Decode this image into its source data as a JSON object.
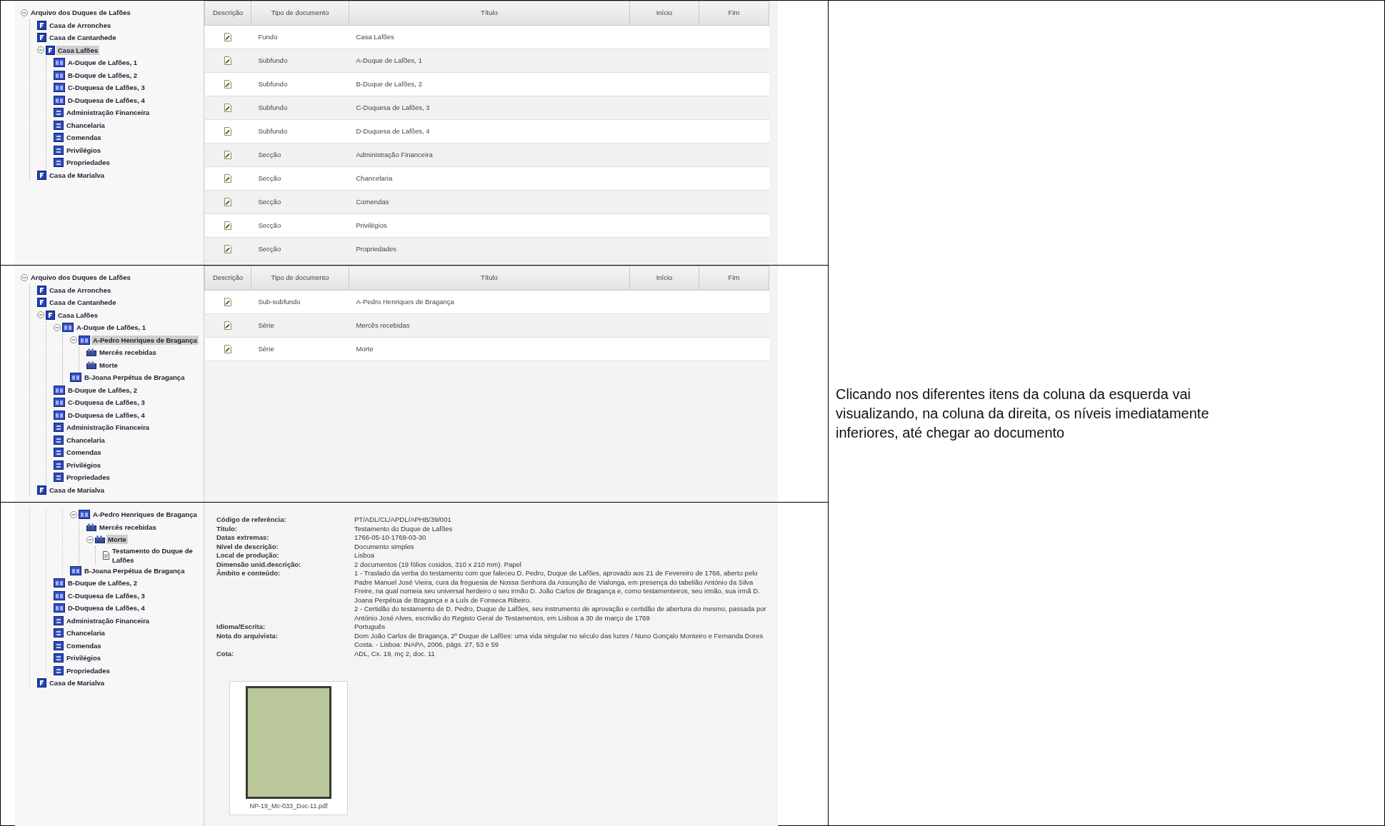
{
  "panels": [
    {
      "kind": "list",
      "tree": [
        {
          "label": "Arquivo dos Duques de Lafões",
          "expanded": true,
          "selected": false,
          "children": [
            {
              "label": "Casa de Arronches",
              "kind": "fonds",
              "selected": false
            },
            {
              "label": "Casa de Cantanhede",
              "kind": "fonds",
              "selected": false
            },
            {
              "label": "Casa Lafões",
              "kind": "fonds",
              "expanded": true,
              "selected": true,
              "children": [
                {
                  "label": "A-Duque de Lafões, 1",
                  "kind": "subfonds",
                  "selected": false
                },
                {
                  "label": "B-Duque de Lafões, 2",
                  "kind": "subfonds",
                  "selected": false
                },
                {
                  "label": "C-Duquesa de Lafões, 3",
                  "kind": "subfonds",
                  "selected": false
                },
                {
                  "label": "D-Duquesa de Lafões, 4",
                  "kind": "subfonds",
                  "selected": false
                },
                {
                  "label": "Administração Financeira",
                  "kind": "section",
                  "selected": false
                },
                {
                  "label": "Chancelaria",
                  "kind": "section",
                  "selected": false
                },
                {
                  "label": "Comendas",
                  "kind": "section",
                  "selected": false
                },
                {
                  "label": "Privilégios",
                  "kind": "section",
                  "selected": false
                },
                {
                  "label": "Propriedades",
                  "kind": "section",
                  "selected": false
                }
              ]
            },
            {
              "label": "Casa de Marialva",
              "kind": "fonds",
              "selected": false
            }
          ]
        }
      ],
      "table": {
        "columns": [
          "Descrição",
          "Tipo de documento",
          "Título",
          "Início",
          "Fim"
        ],
        "rows": [
          {
            "type": "Fundo",
            "title": "Casa Lafões"
          },
          {
            "type": "Subfundo",
            "title": "A-Duque de Lafões, 1"
          },
          {
            "type": "Subfundo",
            "title": "B-Duque de Lafões, 2"
          },
          {
            "type": "Subfundo",
            "title": "C-Duquesa de Lafões, 3"
          },
          {
            "type": "Subfundo",
            "title": "D-Duquesa de Lafões, 4"
          },
          {
            "type": "Secção",
            "title": "Administração Financeira"
          },
          {
            "type": "Secção",
            "title": "Chancelaria"
          },
          {
            "type": "Secção",
            "title": "Comendas"
          },
          {
            "type": "Secção",
            "title": "Privilégios"
          },
          {
            "type": "Secção",
            "title": "Propriedades"
          }
        ]
      }
    },
    {
      "kind": "list",
      "tree": [
        {
          "label": "Arquivo dos Duques de Lafões",
          "expanded": true,
          "selected": false,
          "children": [
            {
              "label": "Casa de Arronches",
              "kind": "fonds",
              "selected": false
            },
            {
              "label": "Casa de Cantanhede",
              "kind": "fonds",
              "selected": false
            },
            {
              "label": "Casa Lafões",
              "kind": "fonds",
              "expanded": true,
              "selected": false,
              "children": [
                {
                  "label": "A-Duque de Lafões, 1",
                  "kind": "subfonds",
                  "expanded": true,
                  "selected": false,
                  "children": [
                    {
                      "label": "A-Pedro Henriques de Bragança",
                      "kind": "subfonds",
                      "expanded": true,
                      "selected": true,
                      "children": [
                        {
                          "label": "Mercês recebidas",
                          "kind": "series",
                          "selected": false
                        },
                        {
                          "label": "Morte",
                          "kind": "series",
                          "selected": false
                        }
                      ]
                    },
                    {
                      "label": "B-Joana Perpétua de Bragança",
                      "kind": "subfonds",
                      "selected": false
                    }
                  ]
                },
                {
                  "label": "B-Duque de Lafões, 2",
                  "kind": "subfonds",
                  "selected": false
                },
                {
                  "label": "C-Duquesa de Lafões, 3",
                  "kind": "subfonds",
                  "selected": false
                },
                {
                  "label": "D-Duquesa de Lafões, 4",
                  "kind": "subfonds",
                  "selected": false
                },
                {
                  "label": "Administração Financeira",
                  "kind": "section",
                  "selected": false
                },
                {
                  "label": "Chancelaria",
                  "kind": "section",
                  "selected": false
                },
                {
                  "label": "Comendas",
                  "kind": "section",
                  "selected": false
                },
                {
                  "label": "Privilégios",
                  "kind": "section",
                  "selected": false
                },
                {
                  "label": "Propriedades",
                  "kind": "section",
                  "selected": false
                }
              ]
            },
            {
              "label": "Casa de Marialva",
              "kind": "fonds",
              "selected": false
            }
          ]
        }
      ],
      "table": {
        "columns": [
          "Descrição",
          "Tipo de documento",
          "Título",
          "Início",
          "Fim"
        ],
        "rows": [
          {
            "type": "Sub-subfundo",
            "title": "A-Pedro Henriques de Bragança"
          },
          {
            "type": "Série",
            "title": "Mercês recebidas"
          },
          {
            "type": "Série",
            "title": "Morte"
          }
        ]
      }
    },
    {
      "kind": "detail",
      "tree": [
        {
          "children": [
            {
              "children": [
                {
                  "children": [
                    {
                      "label": "A-Pedro Henriques de Bragança",
                      "kind": "subfonds",
                      "expanded": true,
                      "selected": false,
                      "children": [
                        {
                          "label": "Mercês recebidas",
                          "kind": "series",
                          "selected": false
                        },
                        {
                          "label": "Morte",
                          "kind": "series",
                          "expanded": true,
                          "selected": true,
                          "children": [
                            {
                              "label": "Testamento do Duque de Lafões",
                              "kind": "document",
                              "selected": false
                            }
                          ]
                        }
                      ]
                    },
                    {
                      "label": "B-Joana Perpétua de Bragança",
                      "kind": "subfonds",
                      "selected": false
                    }
                  ]
                },
                {
                  "label": "B-Duque de Lafões, 2",
                  "kind": "subfonds",
                  "selected": false
                },
                {
                  "label": "C-Duquesa de Lafões, 3",
                  "kind": "subfonds",
                  "selected": false
                },
                {
                  "label": "D-Duquesa de Lafões, 4",
                  "kind": "subfonds",
                  "selected": false
                },
                {
                  "label": "Administração Financeira",
                  "kind": "section",
                  "selected": false
                },
                {
                  "label": "Chancelaria",
                  "kind": "section",
                  "selected": false
                },
                {
                  "label": "Comendas",
                  "kind": "section",
                  "selected": false
                },
                {
                  "label": "Privilégios",
                  "kind": "section",
                  "selected": false
                },
                {
                  "label": "Propriedades",
                  "kind": "section",
                  "selected": false
                }
              ]
            },
            {
              "label": "Casa de Marialva",
              "kind": "fonds",
              "selected": false
            }
          ]
        }
      ],
      "fields": [
        {
          "label": "Código de referência:",
          "values": [
            "PT/ADL/CL/APDL/APHB/39/001"
          ]
        },
        {
          "label": "Título:",
          "values": [
            "Testamento do Duque de Lafões"
          ]
        },
        {
          "label": "Datas extremas:",
          "values": [
            "1766-05-10-1769-03-30"
          ]
        },
        {
          "label": "Nível de descrição:",
          "values": [
            "Documento simples"
          ]
        },
        {
          "label": "Local de produção:",
          "values": [
            "Lisboa"
          ]
        },
        {
          "label": "Dimensão unid.descrição:",
          "values": [
            "2 documentos (19 fólios cosidos, 310 x 210 mm). Papel"
          ]
        },
        {
          "label": "Âmbito e conteúdo:",
          "values": [
            "1 - Traslado da verba do testamento com que faleceu D. Pedro, Duque de Lafões, aprovado aos 21 de Fevereiro de 1766, aberto pelo Padre Manuel José Vieira, cura da freguesia de Nossa Senhora da Assunção de Vialonga, em presença do tabelião António da Silva Freire, na qual nomeia seu universal herdeiro o seu irmão D. João Carlos de Bragança e, como testamenteiros, seu irmão, sua irmã D. Joana Perpétua de Bragança e a Luís de Fonseca Ribeiro.",
            "2 - Certidão do testamento de D. Pedro, Duque de Lafões, seu instrumento de aprovação e certidão de abertura do mesmo, passada por António José Alves, escrivão do Registo Geral de Testamentos, em Lisboa a 30 de março de 1769"
          ]
        },
        {
          "label": "Idioma/Escrita:",
          "values": [
            "Português"
          ]
        },
        {
          "label": "Nota do arquivista:",
          "values": [
            "Dom João Carlos de Bragança, 2º Duque de Lafões: uma vida singular no século das luzes / Nuno Gonçalo Monteiro e Fernanda Dores Costa. - Lisboa: INAPA, 2006, págs. 27, 53 e 59"
          ]
        },
        {
          "label": "Cota:",
          "values": [
            "ADL, Cx. 19, mç 2, doc. 11"
          ]
        }
      ],
      "attachment": {
        "filename": "NP-19_Mc-033_Doc-11.pdf"
      }
    }
  ],
  "caption": "Clicando nos diferentes itens da coluna da esquerda vai visualizando, na coluna da direita, os níveis imediatamente inferiores, até chegar ao documento"
}
